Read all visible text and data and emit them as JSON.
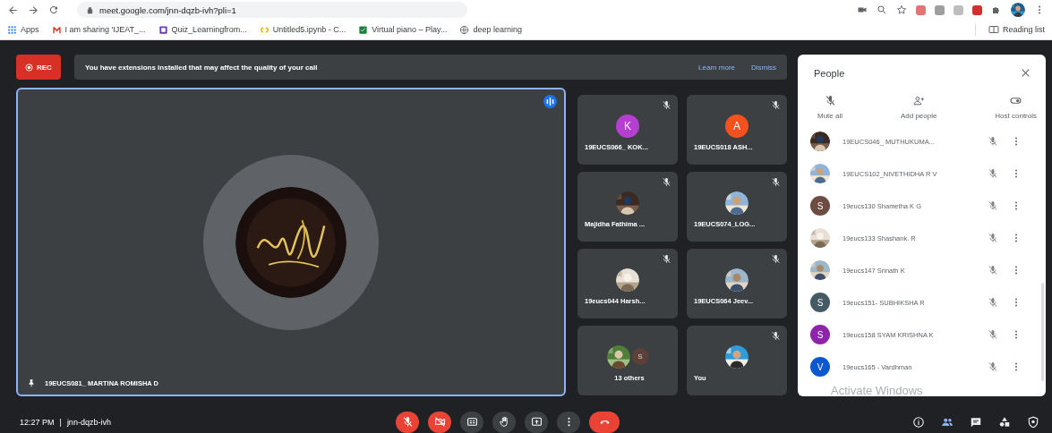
{
  "browser": {
    "url": "meet.google.com/jnn-dqzb-ivh?pli=1",
    "bookmarks": [
      {
        "kind": "apps",
        "label": "Apps"
      },
      {
        "kind": "mail",
        "label": "I am sharing 'IJEAT_..."
      },
      {
        "kind": "form",
        "label": "Quiz_Learningfrom..."
      },
      {
        "kind": "colab",
        "label": "Untitled5.ipynb - C..."
      },
      {
        "kind": "sheet",
        "label": "Virtual piano – Play..."
      },
      {
        "kind": "globe",
        "label": "deep learning"
      }
    ],
    "reading_list": "Reading list"
  },
  "rec_button": "REC",
  "banner": {
    "message": "You have extensions installed that may affect the quality of your call",
    "links": [
      "Learn more",
      "Dismiss"
    ]
  },
  "main_tile": {
    "name": "19EUCS081_ MARTINA ROMISHA D"
  },
  "grid": [
    {
      "name": "19EUCS066_ KOK...",
      "avatar": {
        "kind": "letter",
        "letter": "K",
        "color": "#b53fd0"
      },
      "muted": true
    },
    {
      "name": "19EUCS018 ASH...",
      "avatar": {
        "kind": "letter",
        "letter": "A",
        "color": "#f4511e"
      },
      "muted": true
    },
    {
      "name": "Majidha Fathima ...",
      "muted": true
    },
    {
      "name": "19EUCS074_LOG...",
      "muted": true
    },
    {
      "name": "19eucs044 Harsh...",
      "muted": true
    },
    {
      "name": "19EUCS064 Jeev...",
      "muted": true
    },
    {
      "name": "13 others",
      "avatar": {
        "kind": "group",
        "letter": "S",
        "color": "#5d4037"
      },
      "muted": false
    },
    {
      "name": "You",
      "muted": true
    }
  ],
  "people_panel": {
    "title": "People",
    "actions": [
      {
        "kind": "mute",
        "label": "Mute all"
      },
      {
        "kind": "add",
        "label": "Add people"
      },
      {
        "kind": "toggle",
        "label": "Host controls"
      }
    ],
    "people": [
      {
        "name": "19EUCS046_ MUTHUKUMA..."
      },
      {
        "name": "19EUCS102_NIVETHIDHA R V"
      },
      {
        "name": "19eucs130 Shametha K G",
        "avatar": {
          "kind": "letter",
          "letter": "S",
          "color": "#6d4c41"
        }
      },
      {
        "name": "19eucs133 Shashank. R"
      },
      {
        "name": "19eucs147 Srinath K"
      },
      {
        "name": "19eucs151- SUBHIKSHA R",
        "avatar": {
          "kind": "letter",
          "letter": "S",
          "color": "#455a64"
        }
      },
      {
        "name": "19eucs158 SYAM KRISHNA K",
        "avatar": {
          "kind": "letter",
          "letter": "S",
          "color": "#8e24aa"
        }
      },
      {
        "name": "19eucs165 - Vardhman",
        "avatar": {
          "kind": "letter",
          "letter": "V",
          "color": "#0b57d0"
        }
      }
    ]
  },
  "call_bar": {
    "time": "12:27 PM",
    "separator": "|",
    "meeting_code": "jnn-dqzb-ivh",
    "controls": [
      {
        "kind": "mic",
        "on": false
      },
      {
        "kind": "camera",
        "on": false
      },
      {
        "kind": "captions"
      },
      {
        "kind": "hand"
      },
      {
        "kind": "present"
      },
      {
        "kind": "more"
      },
      {
        "kind": "end"
      }
    ],
    "side_buttons": [
      {
        "kind": "info"
      },
      {
        "kind": "people",
        "selected": true
      },
      {
        "kind": "chat",
        "selected": false
      },
      {
        "kind": "activities",
        "selected": false
      },
      {
        "kind": "lock",
        "selected": false
      }
    ]
  },
  "os_notice": "Activate Windows"
}
